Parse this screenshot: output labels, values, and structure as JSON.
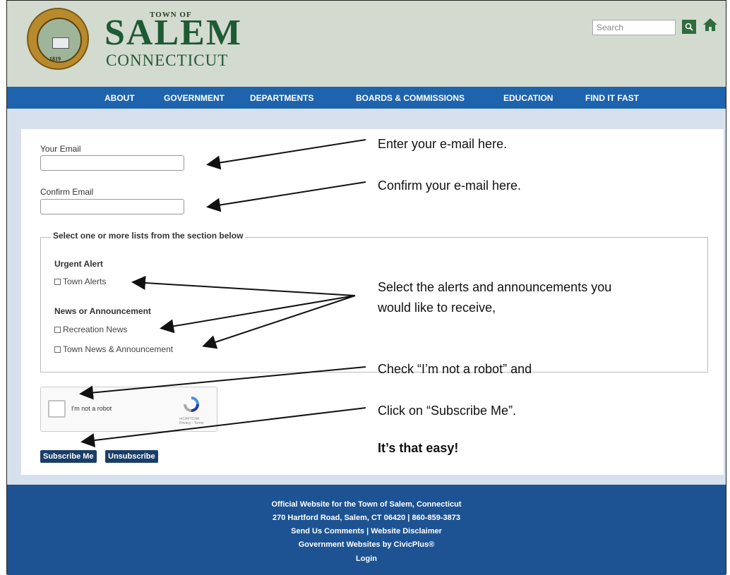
{
  "header": {
    "town_of": "TOWN OF",
    "title": "SALEM",
    "subtitle": "CONNECTICUT",
    "seal_year": "1819",
    "search_placeholder": "Search"
  },
  "nav": {
    "items": [
      "ABOUT",
      "GOVERNMENT",
      "DEPARTMENTS",
      "BOARDS & COMMISSIONS",
      "EDUCATION",
      "FIND IT FAST"
    ]
  },
  "form": {
    "email_label": "Your Email",
    "confirm_label": "Confirm Email",
    "fieldset_legend": "Select one or more lists from the section below",
    "groups": [
      {
        "title": "Urgent Alert",
        "items": [
          "Town Alerts"
        ]
      },
      {
        "title": "News or Announcement",
        "items": [
          "Recreation News",
          "Town News & Announcement"
        ]
      }
    ],
    "captcha_label": "I'm not a robot",
    "captcha_sub": "reCAPTCHA",
    "captcha_links": "Privacy - Terms",
    "subscribe_label": "Subscribe Me",
    "unsubscribe_label": "Unsubscribe"
  },
  "annotations": {
    "email": "Enter your e-mail here.",
    "confirm": "Confirm your e-mail here.",
    "alerts_line1": "Select the alerts and announcements you",
    "alerts_line2": "would like to receive,",
    "robot": "Check “I’m not a robot” and",
    "subscribe": "Click on “Subscribe Me”.",
    "easy": "It’s that easy!"
  },
  "footer": {
    "line1": "Official Website for the Town of Salem, Connecticut",
    "line2": "270 Hartford Road, Salem, CT 06420 | 860-859-3873",
    "line3": "Send Us Comments  |  Website Disclaimer",
    "line4": "Government Websites by CivicPlus®",
    "line5": "Login"
  },
  "colors": {
    "nav": "#1d63ad",
    "footer": "#1d5392",
    "brand_green": "#1e5a34",
    "button": "#1a3e68"
  }
}
